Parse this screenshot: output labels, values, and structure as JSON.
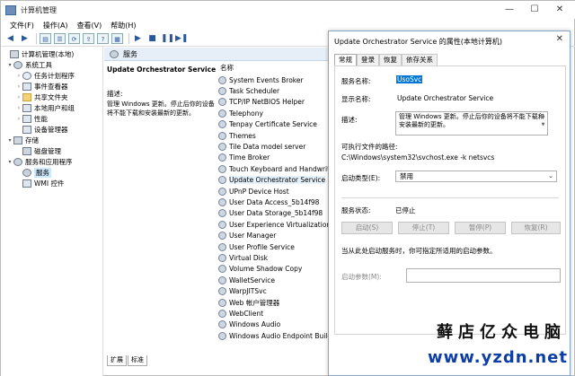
{
  "window": {
    "title": "计算机管理",
    "controls": [
      "—",
      "☐",
      "✕"
    ]
  },
  "menu": [
    "文件(F)",
    "操作(A)",
    "查看(V)",
    "帮助(H)"
  ],
  "tree": {
    "items": [
      {
        "label": "计算机管理(本地)",
        "indent": 0,
        "arrow": "",
        "icon": "computer-icon"
      },
      {
        "label": "系统工具",
        "indent": 1,
        "arrow": "▾",
        "icon": "tools-icon"
      },
      {
        "label": "任务计划程序",
        "indent": 2,
        "arrow": "›",
        "icon": "clock-icon"
      },
      {
        "label": "事件查看器",
        "indent": 2,
        "arrow": "›",
        "icon": "event-viewer-icon"
      },
      {
        "label": "共享文件夹",
        "indent": 2,
        "arrow": "›",
        "icon": "folder-icon"
      },
      {
        "label": "本地用户和组",
        "indent": 2,
        "arrow": "›",
        "icon": "users-icon"
      },
      {
        "label": "性能",
        "indent": 2,
        "arrow": "›",
        "icon": "performance-icon"
      },
      {
        "label": "设备管理器",
        "indent": 2,
        "arrow": "",
        "icon": "device-manager-icon"
      },
      {
        "label": "存储",
        "indent": 1,
        "arrow": "▾",
        "icon": "storage-icon"
      },
      {
        "label": "磁盘管理",
        "indent": 2,
        "arrow": "",
        "icon": "disk-icon"
      },
      {
        "label": "服务和应用程序",
        "indent": 1,
        "arrow": "▾",
        "icon": "services-apps-icon"
      },
      {
        "label": "服务",
        "indent": 2,
        "arrow": "",
        "icon": "gear-icon",
        "selected": true
      },
      {
        "label": "WMI 控件",
        "indent": 2,
        "arrow": "",
        "icon": "wmi-icon"
      }
    ]
  },
  "services_panel": {
    "header": "服务",
    "selected_name": "Update Orchestrator Service",
    "desc_label": "描述:",
    "desc_text": "管理 Windows 更新。停止后你的设备将不能下载和安装最新的更新。",
    "column_name": "名称",
    "rows": [
      "System Events Broker",
      "Task Scheduler",
      "TCP/IP NetBIOS Helper",
      "Telephony",
      "Tenpay Certificate Service",
      "Themes",
      "Tile Data model server",
      "Time Broker",
      "Touch Keyboard and Handwriting",
      "Update Orchestrator Service",
      "UPnP Device Host",
      "User Data Access_5b14f98",
      "User Data Storage_5b14f98",
      "User Experience Virtualization Se",
      "User Manager",
      "User Profile Service",
      "Virtual Disk",
      "Volume Shadow Copy",
      "WalletService",
      "WarpJITSvc",
      "Web 帐户管理器",
      "WebClient",
      "Windows Audio",
      "Windows Audio Endpoint Builde"
    ],
    "tabs": [
      "扩展",
      "标准"
    ]
  },
  "dialog": {
    "title": "Update Orchestrator Service 的属性(本地计算机)",
    "close": "✕",
    "tabs": [
      "常规",
      "登录",
      "恢复",
      "依存关系"
    ],
    "service_name_label": "服务名称:",
    "service_name_value": "UsoSvc",
    "display_name_label": "显示名称:",
    "display_name_value": "Update Orchestrator Service",
    "description_label": "描述:",
    "description_value": "管理 Windows 更新。停止后你的设备将不能下载和安装最新的更新。",
    "exe_path_label": "可执行文件的路径:",
    "exe_path_value": "C:\\Windows\\system32\\svchost.exe -k netsvcs",
    "startup_type_label": "启动类型(E):",
    "startup_type_value": "禁用",
    "status_label": "服务状态:",
    "status_value": "已停止",
    "buttons": {
      "start": "启动(S)",
      "stop": "停止(T)",
      "pause": "暂停(P)",
      "resume": "恢复(R)"
    },
    "hint": "当从此处启动服务时，你可指定所适用的启动参数。",
    "params_label": "启动参数(M):"
  },
  "watermark": {
    "text": "藓店亿众电脑",
    "url": "www.yzdn.net"
  }
}
